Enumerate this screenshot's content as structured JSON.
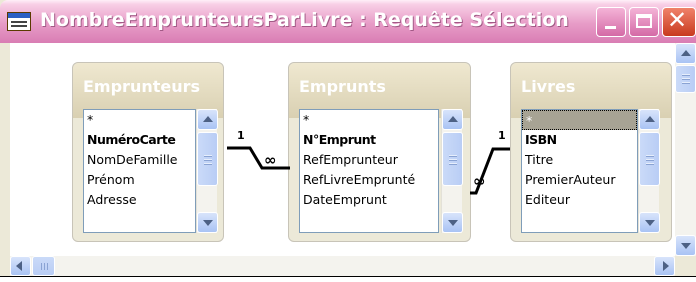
{
  "window": {
    "title": "NombreEmprunteursParLivre : Requête Sélection",
    "icon": "query-design-icon",
    "controls": [
      "minimize-icon",
      "maximize-icon",
      "close-icon"
    ],
    "close_glyph": "✕"
  },
  "tables": [
    {
      "name": "Emprunteurs",
      "fields": [
        "*",
        "NuméroCarte",
        "NomDeFamille",
        "Prénom",
        "Adresse"
      ],
      "key_field": "NuméroCarte"
    },
    {
      "name": "Emprunts",
      "fields": [
        "*",
        "N°Emprunt",
        "RefEmprunteur",
        "RefLivreEmprunté",
        "DateEmprunt"
      ],
      "key_field": "N°Emprunt"
    },
    {
      "name": "Livres",
      "fields": [
        "*",
        "ISBN",
        "Titre",
        "PremierAuteur",
        "Editeur"
      ],
      "key_field": "ISBN",
      "selected_field": "*"
    }
  ],
  "relationships": [
    {
      "from": "Emprunteurs.NuméroCarte",
      "to": "Emprunts.RefEmprunteur",
      "one_label": "1",
      "many_label": "∞"
    },
    {
      "from": "Livres.ISBN",
      "to": "Emprunts.RefLivreEmprunté",
      "one_label": "1",
      "many_label": "∞"
    }
  ],
  "colors": {
    "titlebar": "#e79cc7",
    "close_button": "#d9452a",
    "scroll_button": "#b9cdf5",
    "selection": "#a7a394"
  }
}
